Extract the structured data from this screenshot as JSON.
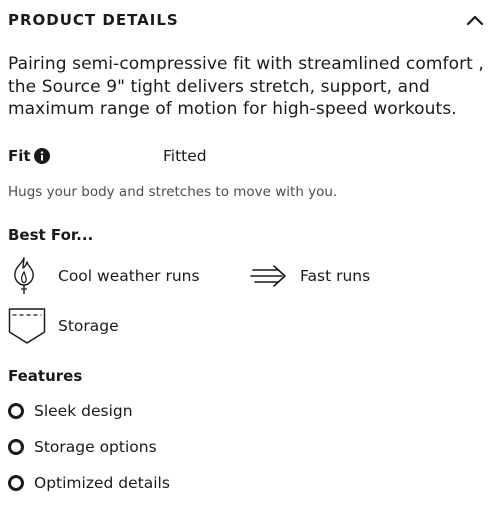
{
  "header": {
    "title": "PRODUCT DETAILS",
    "toggle_icon": "chevron-up-icon",
    "expanded": true
  },
  "description": "Pairing semi-compressive fit with streamlined comfort , the Source 9\" tight delivers stretch, support, and maximum range of motion for high-speed workouts.",
  "fit": {
    "label": "Fit",
    "info_icon": "info-icon",
    "value": "Fitted",
    "description": "Hugs your body and stretches to move with you."
  },
  "best_for": {
    "title": "Best For...",
    "items": [
      {
        "label": "Cool weather runs",
        "icon": "flame-icon"
      },
      {
        "label": "Fast runs",
        "icon": "speed-arrow-icon"
      },
      {
        "label": "Storage",
        "icon": "pocket-icon"
      }
    ]
  },
  "features": {
    "title": "Features",
    "items": [
      {
        "label": "Sleek design"
      },
      {
        "label": "Storage options"
      },
      {
        "label": "Optimized details"
      }
    ]
  }
}
